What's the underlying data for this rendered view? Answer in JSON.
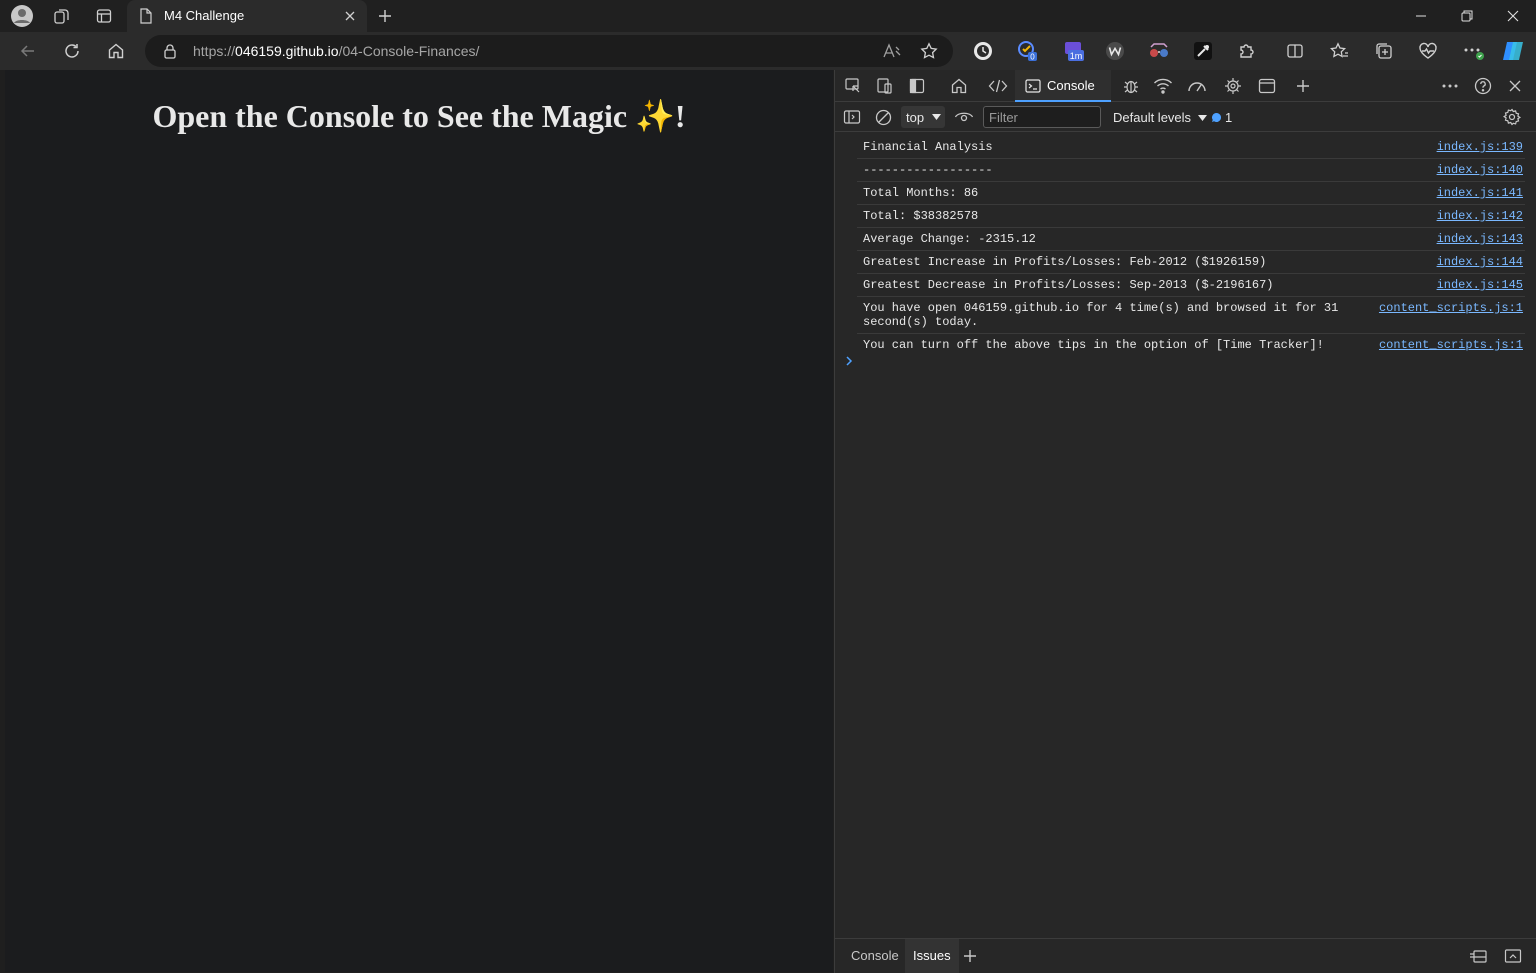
{
  "tab": {
    "title": "M4 Challenge"
  },
  "address": {
    "url_prefix": "https://",
    "url_host": "046159.github.io",
    "url_path": "/04-Console-Finances/"
  },
  "page": {
    "heading": "Open the Console to See the Magic ✨!"
  },
  "extensions": [
    {
      "name": "tracker-extension-icon",
      "badge": ""
    },
    {
      "name": "checklist-extension-icon",
      "badge": "0"
    },
    {
      "name": "timer-extension-icon",
      "badge": "1m"
    },
    {
      "name": "wordtune-extension-icon",
      "badge": ""
    },
    {
      "name": "glasses-extension-icon",
      "badge": ""
    },
    {
      "name": "eyedropper-extension-icon",
      "badge": ""
    },
    {
      "name": "puzzle-extensions-icon",
      "badge": ""
    }
  ],
  "devtools": {
    "console_tab": "Console",
    "context": "top",
    "filter_placeholder": "Filter",
    "levels": "Default levels",
    "issues_count": "1",
    "drawer_tabs": [
      "Console",
      "Issues"
    ]
  },
  "console": [
    {
      "text": "Financial Analysis",
      "source": "index.js:139"
    },
    {
      "text": "------------------",
      "source": "index.js:140"
    },
    {
      "text": "Total Months: 86",
      "source": "index.js:141"
    },
    {
      "text": "Total: $38382578",
      "source": "index.js:142"
    },
    {
      "text": "Average Change: -2315.12",
      "source": "index.js:143"
    },
    {
      "text": "Greatest Increase in Profits/Losses: Feb-2012 ($1926159)",
      "source": "index.js:144"
    },
    {
      "text": "Greatest Decrease in Profits/Losses: Sep-2013 ($-2196167)",
      "source": "index.js:145"
    },
    {
      "text": "You have open 046159.github.io for 4 time(s) and browsed it for 31 second(s) today.",
      "source": "content_scripts.js:1"
    },
    {
      "text": "You can turn off the above tips in the option of [Time Tracker]!",
      "source": "content_scripts.js:1"
    }
  ],
  "colors": {
    "accent": "#4ea1ff",
    "link": "#7ab8ff",
    "page_bg": "#1b1c1e",
    "devtools_bg": "#272727"
  }
}
